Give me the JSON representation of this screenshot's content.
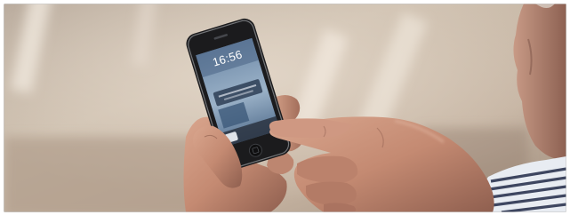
{
  "photo": {
    "subject": "",
    "colors": {
      "background_light": "#cdbfae",
      "background_mid": "#a8998a",
      "skin": "#c9937c",
      "skin_shadow": "#8d5d4d",
      "phone_body": "#1b1b1d",
      "phone_screen": "#7e98b3",
      "shirt_stripe": "#2c3550"
    },
    "phone_screen": {
      "clock": "16:56"
    }
  }
}
